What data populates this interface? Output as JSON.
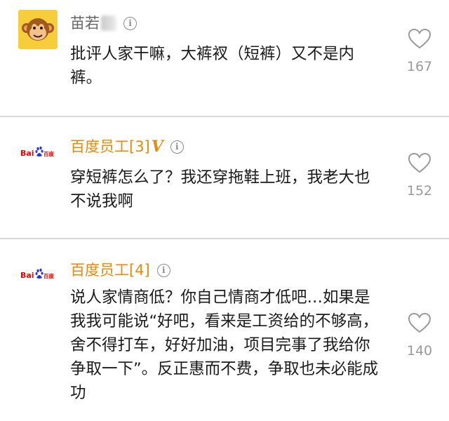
{
  "comments": [
    {
      "username": "苗若",
      "text": "批评人家干嘛，大裤衩（短裤）又不是内裤。",
      "likes": "167",
      "avatar": "monkey-avatar",
      "name_color": "#666666"
    },
    {
      "username": "百度员工[3]",
      "badge": "V",
      "text": "穿短裤怎么了？我还穿拖鞋上班，我老大也不说我啊",
      "likes": "152",
      "avatar": "baidu-logo",
      "avatar_text": "Bai百度",
      "name_color": "#e58a0d"
    },
    {
      "username": "百度员工[4]",
      "text": "说人家情商低？你自己情商才低吧…如果是我我可能说“好吧，看来是工资给的不够高，舍不得打车，好好加油，项目完事了我给你争取一下”。反正惠而不费，争取也未必能成功",
      "likes": "140",
      "avatar": "baidu-logo",
      "avatar_text": "Bai百度",
      "name_color": "#e58a0d"
    }
  ],
  "icons": {
    "info": "info-icon",
    "like": "heart-icon"
  }
}
